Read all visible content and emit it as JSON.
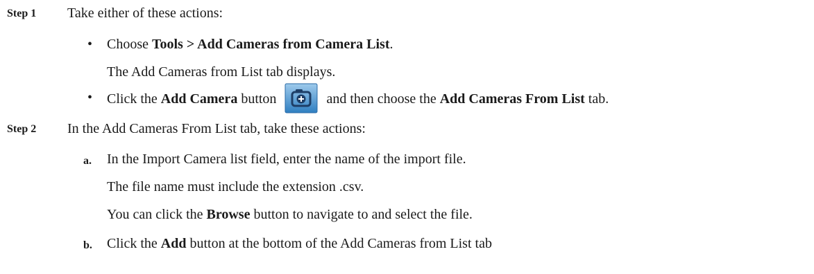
{
  "step1": {
    "label": "Step 1",
    "intro": "Take either of these actions:",
    "bullet1": {
      "prefix": "Choose ",
      "menu_path": "Tools > Add Cameras from Camera List",
      "suffix": ".",
      "result": "The Add Cameras from List tab displays."
    },
    "bullet2": {
      "prefix": "Click the ",
      "button_name": "Add Camera",
      "middle": " button",
      "after_icon": "and then choose the ",
      "tab_name": "Add Cameras From List",
      "suffix": " tab.",
      "icon": "camera-plus-icon"
    }
  },
  "step2": {
    "label": "Step 2",
    "intro": "In the Add Cameras From List tab, take these actions:",
    "item_a": {
      "marker": "a.",
      "text": "In the Import Camera list field, enter the name of the import file.",
      "note1": "The file name must include the extension .csv.",
      "note2_prefix": "You can click the ",
      "note2_button": "Browse",
      "note2_suffix": " button to navigate to and select the file."
    },
    "item_b": {
      "marker": "b.",
      "prefix": "Click the ",
      "button": "Add",
      "suffix": " button at the bottom of the Add Cameras from List tab"
    }
  },
  "colors": {
    "icon_bg": "#2f7fc1",
    "icon_bg_light": "#9ecaec",
    "icon_glyph": "#1e3e66"
  }
}
